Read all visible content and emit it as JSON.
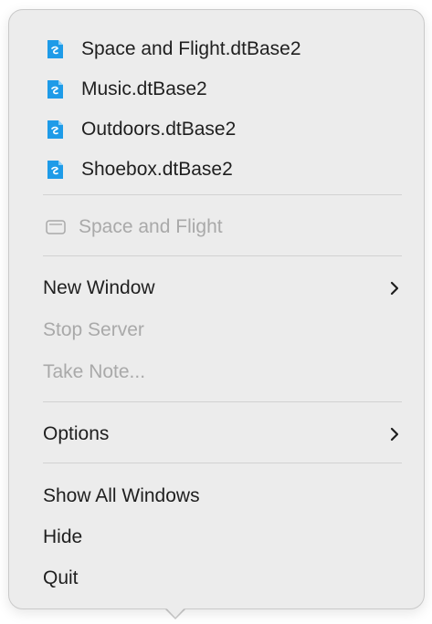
{
  "documents": [
    {
      "label": "Space and Flight.dtBase2",
      "icon": "database-document-icon"
    },
    {
      "label": "Music.dtBase2",
      "icon": "database-document-icon"
    },
    {
      "label": "Outdoors.dtBase2",
      "icon": "database-document-icon"
    },
    {
      "label": "Shoebox.dtBase2",
      "icon": "database-document-icon"
    }
  ],
  "open_window": {
    "label": "Space and Flight",
    "icon": "window-icon",
    "enabled": false
  },
  "actions": {
    "new_window": {
      "label": "New Window",
      "submenu": true,
      "enabled": true
    },
    "stop_server": {
      "label": "Stop Server",
      "enabled": false
    },
    "take_note": {
      "label": "Take Note...",
      "enabled": false
    }
  },
  "options": {
    "label": "Options",
    "submenu": true,
    "enabled": true
  },
  "app": {
    "show_all_windows": {
      "label": "Show All Windows",
      "enabled": true
    },
    "hide": {
      "label": "Hide",
      "enabled": true
    },
    "quit": {
      "label": "Quit",
      "enabled": true
    }
  },
  "colors": {
    "menu_background": "#ececec",
    "text": "#1f1f1f",
    "disabled_text": "#a9a9a9",
    "separator": "#d2d2d2",
    "doc_icon_blue": "#1e9be8"
  }
}
